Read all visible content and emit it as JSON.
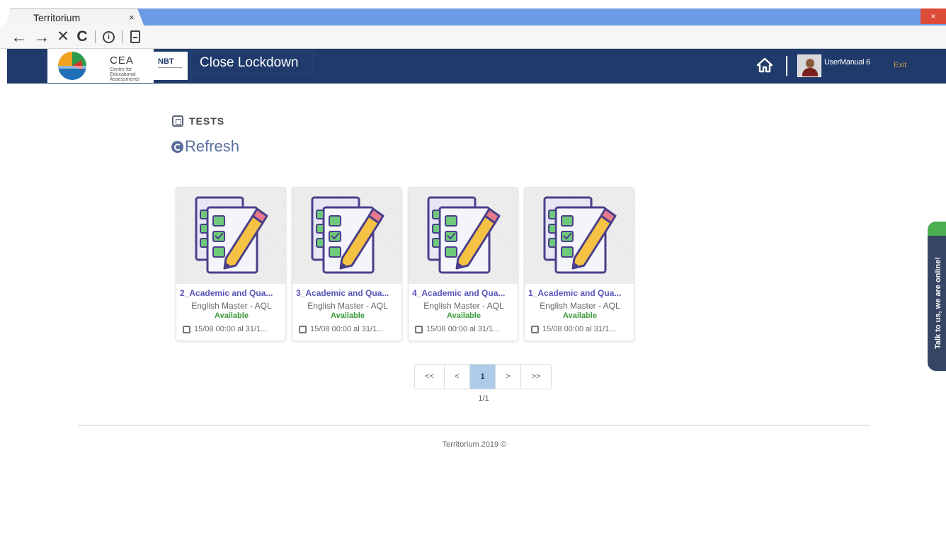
{
  "browser": {
    "tab_title": "Territorium",
    "tab_close": "×",
    "window_close": "×",
    "nav": {
      "back": "←",
      "forward": "→",
      "stop": "✕",
      "reload": "C",
      "info": "i"
    }
  },
  "header": {
    "logo": {
      "title": "CEA",
      "subtitle": "Centre for Educational Assessments"
    },
    "nbt_label": "NBT",
    "close_lockdown": "Close Lockdown",
    "user_name": "UserManual 6",
    "exit_label": "Exit",
    "colors": {
      "bar": "#1f3a6b",
      "exit": "#c79a3a"
    }
  },
  "section": {
    "heading": "TESTS",
    "refresh_label": "Refresh"
  },
  "cards": [
    {
      "title": "2_Academic and Qua...",
      "subtitle": "English Master - AQL",
      "status": "Available",
      "date": "15/08 00:00 al 31/1..."
    },
    {
      "title": "3_Academic and Qua...",
      "subtitle": "English Master - AQL",
      "status": "Available",
      "date": "15/08 00:00 al 31/1..."
    },
    {
      "title": "4_Academic and Qua...",
      "subtitle": "English Master - AQL",
      "status": "Available",
      "date": "15/08 00:00 al 31/1..."
    },
    {
      "title": "1_Academic and Qua...",
      "subtitle": "English Master - AQL",
      "status": "Available",
      "date": "15/08 00:00 al 31/1..."
    }
  ],
  "card_icon": "checklist-pencil-icon",
  "pagination": {
    "first": "<<",
    "prev": "<",
    "current": "1",
    "next": ">",
    "last": ">>",
    "page_count": "1/1"
  },
  "footer": "Territorium 2019 ©",
  "chat": {
    "label": "Talk to us, we are online!",
    "colors": {
      "tab": "#364563",
      "cap": "#4caf50"
    }
  },
  "colors": {
    "accent": "#6d9ae4",
    "status_available": "#3a9a3a",
    "card_title": "#5a55b8",
    "page_active": "#aecbe8"
  }
}
